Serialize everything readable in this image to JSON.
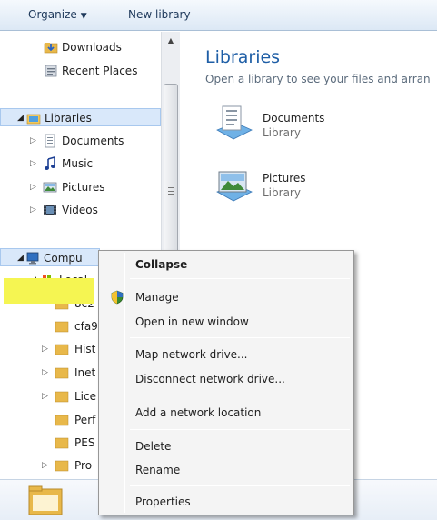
{
  "toolbar": {
    "organize": "Organize",
    "new_library": "New library"
  },
  "nav": {
    "favorites": [
      {
        "label": "Downloads",
        "icon": "downloads-folder-icon"
      },
      {
        "label": "Recent Places",
        "icon": "recent-places-icon"
      }
    ],
    "libraries": {
      "label": "Libraries",
      "items": [
        {
          "label": "Documents",
          "icon": "documents-library-icon"
        },
        {
          "label": "Music",
          "icon": "music-library-icon"
        },
        {
          "label": "Pictures",
          "icon": "pictures-library-icon"
        },
        {
          "label": "Videos",
          "icon": "videos-library-icon"
        }
      ]
    },
    "computer": {
      "label": "Compu",
      "drive": "Local",
      "children": [
        "8c2",
        "cfa9",
        "Hist",
        "Inet",
        "Lice",
        "Perf",
        "PES",
        "Pro"
      ]
    }
  },
  "content": {
    "title": "Libraries",
    "subtitle": "Open a library to see your files and arran",
    "items": [
      {
        "name": "Documents",
        "type": "Library"
      },
      {
        "name": "Pictures",
        "type": "Library"
      }
    ]
  },
  "context_menu": {
    "items": [
      "Collapse",
      "Manage",
      "Open in new window",
      "Map network drive...",
      "Disconnect network drive...",
      "Add a network location",
      "Delete",
      "Rename",
      "Properties"
    ]
  },
  "colors": {
    "folder": "#e8b84a",
    "highlight": "#f5f552",
    "title_blue": "#1e5ea6"
  }
}
